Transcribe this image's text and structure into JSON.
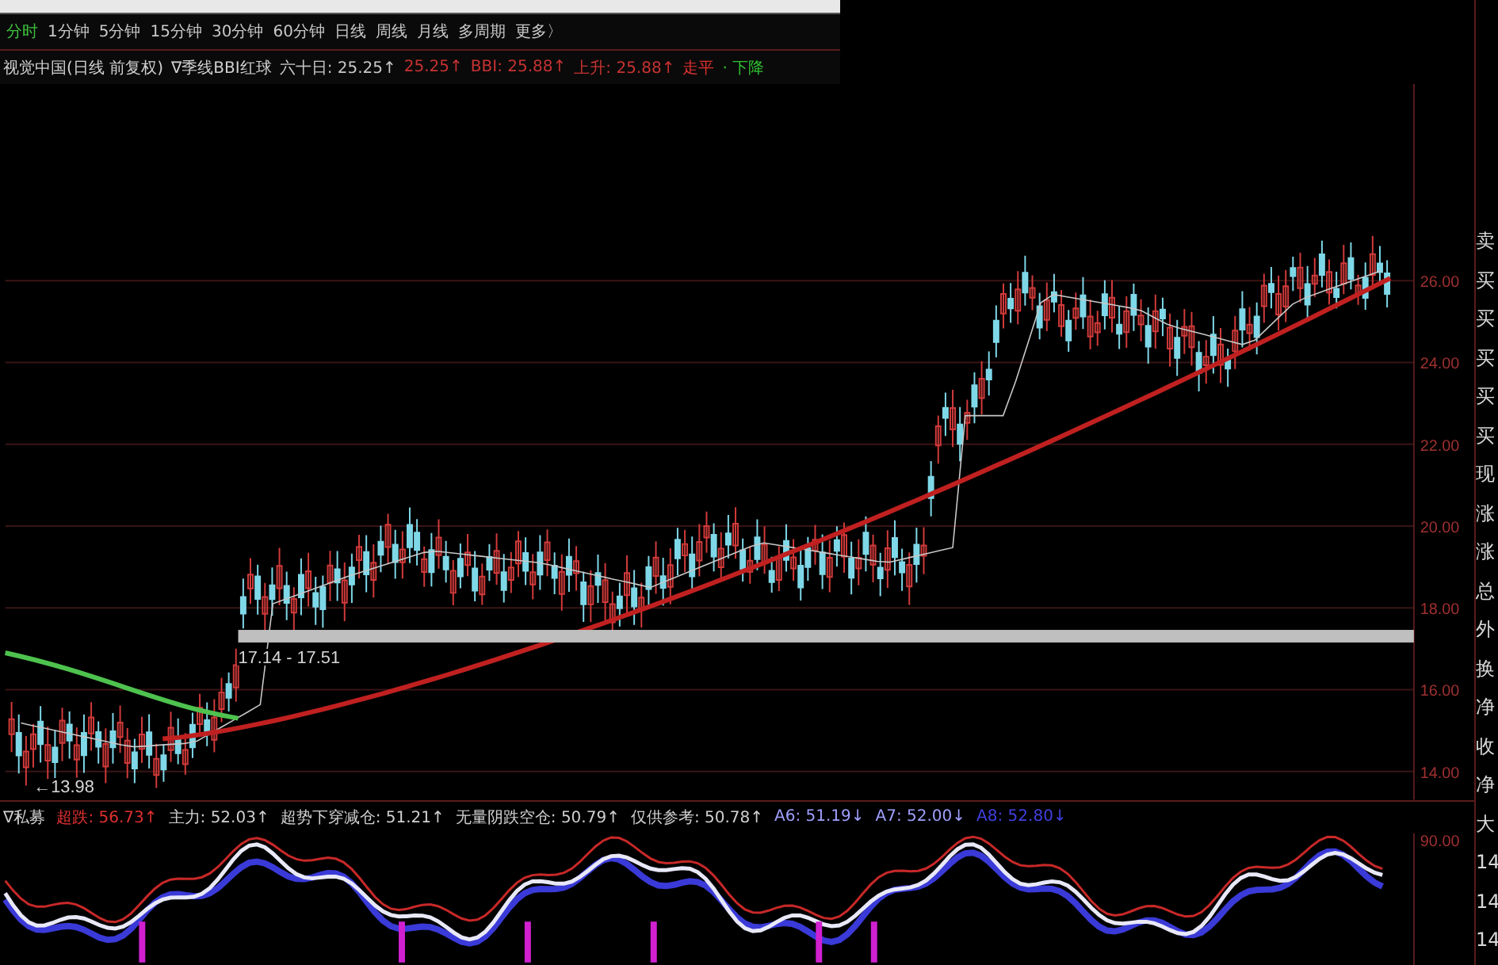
{
  "period_tabs": [
    {
      "label": "分时",
      "selected": true
    },
    {
      "label": "1分钟",
      "selected": false
    },
    {
      "label": "5分钟",
      "selected": false
    },
    {
      "label": "15分钟",
      "selected": false
    },
    {
      "label": "30分钟",
      "selected": false
    },
    {
      "label": "60分钟",
      "selected": false
    },
    {
      "label": "日线",
      "selected": false
    },
    {
      "label": "周线",
      "selected": false
    },
    {
      "label": "月线",
      "selected": false
    },
    {
      "label": "多周期",
      "selected": false
    },
    {
      "label": "更多〉",
      "selected": false
    }
  ],
  "info_line": {
    "stock": "视觉中国(日线 前复权)",
    "indicator": "∇季线BBI红球",
    "items": [
      {
        "text": "六十日: 25.25↑",
        "color": "#c8c8c8"
      },
      {
        "text": "25.25↑",
        "color": "#c83232"
      },
      {
        "text": "BBI: 25.88↑",
        "color": "#c83232"
      },
      {
        "text": "上升: 25.88↑",
        "color": "#c83232"
      },
      {
        "text": "走平",
        "color": "#e03030"
      },
      {
        "text": "· 下降",
        "color": "#30c030"
      }
    ]
  },
  "price_chart": {
    "y_axis_labels": [
      "26.00",
      "24.00",
      "22.00",
      "20.00",
      "18.00",
      "16.00",
      "14.00"
    ],
    "range_label": "17.14 - 17.51",
    "low_label": "←13.98"
  },
  "indicator_line": {
    "name": "∇私募",
    "items": [
      {
        "text": "超跌: 56.73↑",
        "color": "#e03030"
      },
      {
        "text": "主力: 52.03↑",
        "color": "#d0d0d0"
      },
      {
        "text": "超势下穿减仓: 51.21↑",
        "color": "#d0d0d0"
      },
      {
        "text": "无量阴跌空仓: 50.79↑",
        "color": "#d0d0d0"
      },
      {
        "text": "仅供参考: 50.78↑",
        "color": "#d0d0d0"
      },
      {
        "text": "A6: 51.19↓",
        "color": "#a0a0ff"
      },
      {
        "text": "A7: 52.00↓",
        "color": "#a0a0ff"
      },
      {
        "text": "A8: 52.80↓",
        "color": "#4040e0"
      }
    ]
  },
  "indicator_chart": {
    "axis_label": "90.00"
  },
  "side_column": [
    "卖",
    "买",
    "买",
    "买",
    "买",
    "买",
    "现",
    "涨",
    "涨",
    "总",
    "外",
    "换",
    "净",
    "收",
    "净",
    "大",
    "14",
    "14",
    "14"
  ]
}
